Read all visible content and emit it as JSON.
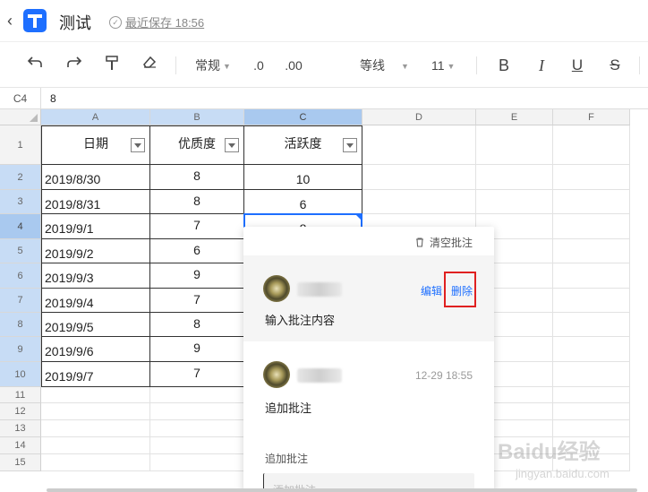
{
  "header": {
    "title": "测试",
    "save_status": "最近保存 18:56"
  },
  "toolbar": {
    "number_format": "常规",
    "decrease_decimal": ".0",
    "increase_decimal": ".00",
    "font_family": "等线",
    "font_size": "11",
    "bold": "B",
    "italic": "I",
    "underline": "U",
    "strikethrough": "S"
  },
  "formula_bar": {
    "cell_ref": "C4",
    "value": "8"
  },
  "sheet": {
    "columns": [
      "A",
      "B",
      "C",
      "D",
      "E",
      "F"
    ],
    "rows": [
      "1",
      "2",
      "3",
      "4",
      "5",
      "6",
      "7",
      "8",
      "9",
      "10",
      "11",
      "12",
      "13",
      "14",
      "15"
    ],
    "table_headers": [
      "日期",
      "优质度",
      "活跃度"
    ],
    "data": [
      {
        "date": "2019/8/30",
        "quality": "8",
        "activity": "10"
      },
      {
        "date": "2019/8/31",
        "quality": "8",
        "activity": "6"
      },
      {
        "date": "2019/9/1",
        "quality": "7",
        "activity": "8"
      },
      {
        "date": "2019/9/2",
        "quality": "6",
        "activity": ""
      },
      {
        "date": "2019/9/3",
        "quality": "9",
        "activity": ""
      },
      {
        "date": "2019/9/4",
        "quality": "7",
        "activity": ""
      },
      {
        "date": "2019/9/5",
        "quality": "8",
        "activity": ""
      },
      {
        "date": "2019/9/6",
        "quality": "9",
        "activity": ""
      },
      {
        "date": "2019/9/7",
        "quality": "7",
        "activity": ""
      }
    ]
  },
  "comments": {
    "clear_label": "清空批注",
    "items": [
      {
        "text": "输入批注内容",
        "edit_label": "编辑",
        "delete_label": "删除"
      },
      {
        "text": "追加批注",
        "time": "12-29 18:55"
      }
    ],
    "add_label": "追加批注",
    "add_placeholder": "添加批注"
  },
  "watermark": {
    "brand": "Baidu经验",
    "url": "jingyan.baidu.com"
  },
  "colors": {
    "accent": "#1e6fff",
    "highlight_box": "#e02020"
  }
}
